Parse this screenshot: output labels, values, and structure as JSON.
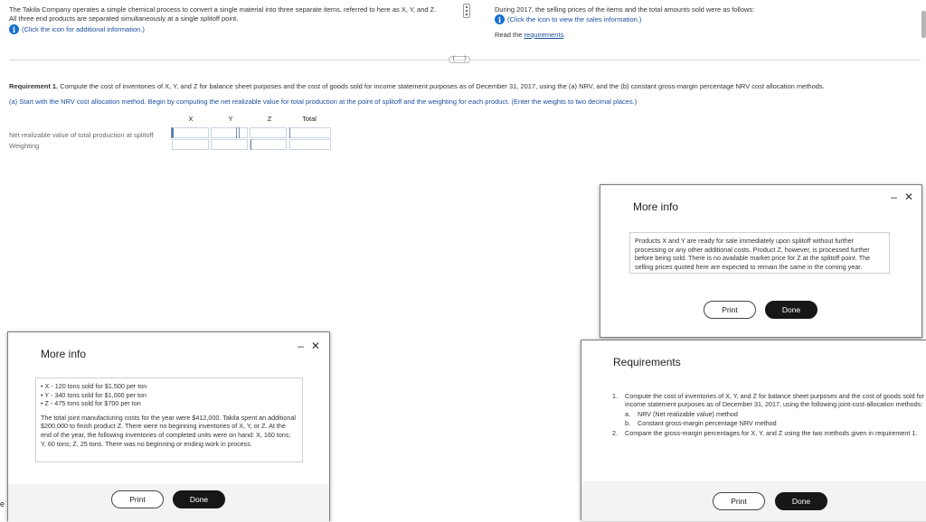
{
  "problem": {
    "intro_line1": "The Takila Company operates a simple chemical process to convert a single material into three separate items, referred to here as X, Y, and Z.",
    "intro_line2": "All three end products are separated simultaneously at a single splitoff point.",
    "info_link_left": "(Click the icon for additional information.)",
    "right_line1": "During 2017, the selling prices of the items and the total amounts sold were as follows:",
    "info_link_right": "(Click the icon to view the sales information.)",
    "read_the": "Read the",
    "requirements_link": "requirements",
    "requirements_period": ".",
    "ellipsis": "(.....)"
  },
  "requirement": {
    "label": "Requirement 1.",
    "text": "Compute the cost of inventories of X, Y, and Z for balance sheet purposes and the cost of goods sold for income statement purposes as of December 31, 2017, using the (a) NRV, and the (b) constant gross-margin percentage NRV cost allocation methods.",
    "part_a": "(a) Start with the NRV cost allocation method. Begin by computing the net realizable value for total production at the point of splitoff and the weighting for each product. (Enter the weights to two decimal places.)"
  },
  "table": {
    "columns": [
      "X",
      "Y",
      "Z",
      "Total"
    ],
    "rows": [
      {
        "label": "Net realizable value of total production at splitoff",
        "values": [
          "",
          "",
          "",
          ""
        ]
      },
      {
        "label": "Weighting",
        "values": [
          "",
          "",
          "",
          ""
        ]
      }
    ]
  },
  "more_info_right": {
    "title": "More info",
    "text": "Products X and Y are ready for sale immediately upon splitoff without further processing or any other additional costs. Product Z, however, is processed further before being sold. There is no available market price for Z at the splitoff point. The selling prices quoted here are expected to remain the same in the coming year.",
    "print": "Print",
    "done": "Done",
    "minimize": "‒",
    "close": "✕"
  },
  "more_info_left": {
    "title": "More info",
    "bullets": [
      "X - 120 tons sold for $1,500 per ton",
      "Y - 340 tons sold for $1,000 per ton",
      "Z - 475 tons sold for $700 per ton"
    ],
    "text": "The total joint manufacturing costs for the year were $412,000. Takila spent an additional $200,000 to finish product Z. There were no beginning inventories of X, Y, or Z. At the end of the year, the following inventories of completed units were on hand: X, 160 tons; Y, 60 tons; Z, 25 tons. There was no beginning or ending work in process.",
    "print": "Print",
    "done": "Done",
    "minimize": "‒",
    "close": "✕"
  },
  "requirements_panel": {
    "title": "Requirements",
    "items": [
      {
        "num": "1.",
        "text": "Compute the cost of inventories of X, Y, and Z for balance sheet purposes and the cost of goods sold for income statement purposes as of December 31, 2017, using the following joint-cost-allocation methods:"
      },
      {
        "num": "a.",
        "text": "NRV (Net realizable value) method"
      },
      {
        "num": "b.",
        "text": "Constant gross-margin percentage NRV method"
      },
      {
        "num": "2.",
        "text": "Compare the gross-margin percentages for X, Y, and Z using the two methods given in requirement 1."
      }
    ],
    "print": "Print",
    "done": "Done"
  },
  "edge_char": "e"
}
